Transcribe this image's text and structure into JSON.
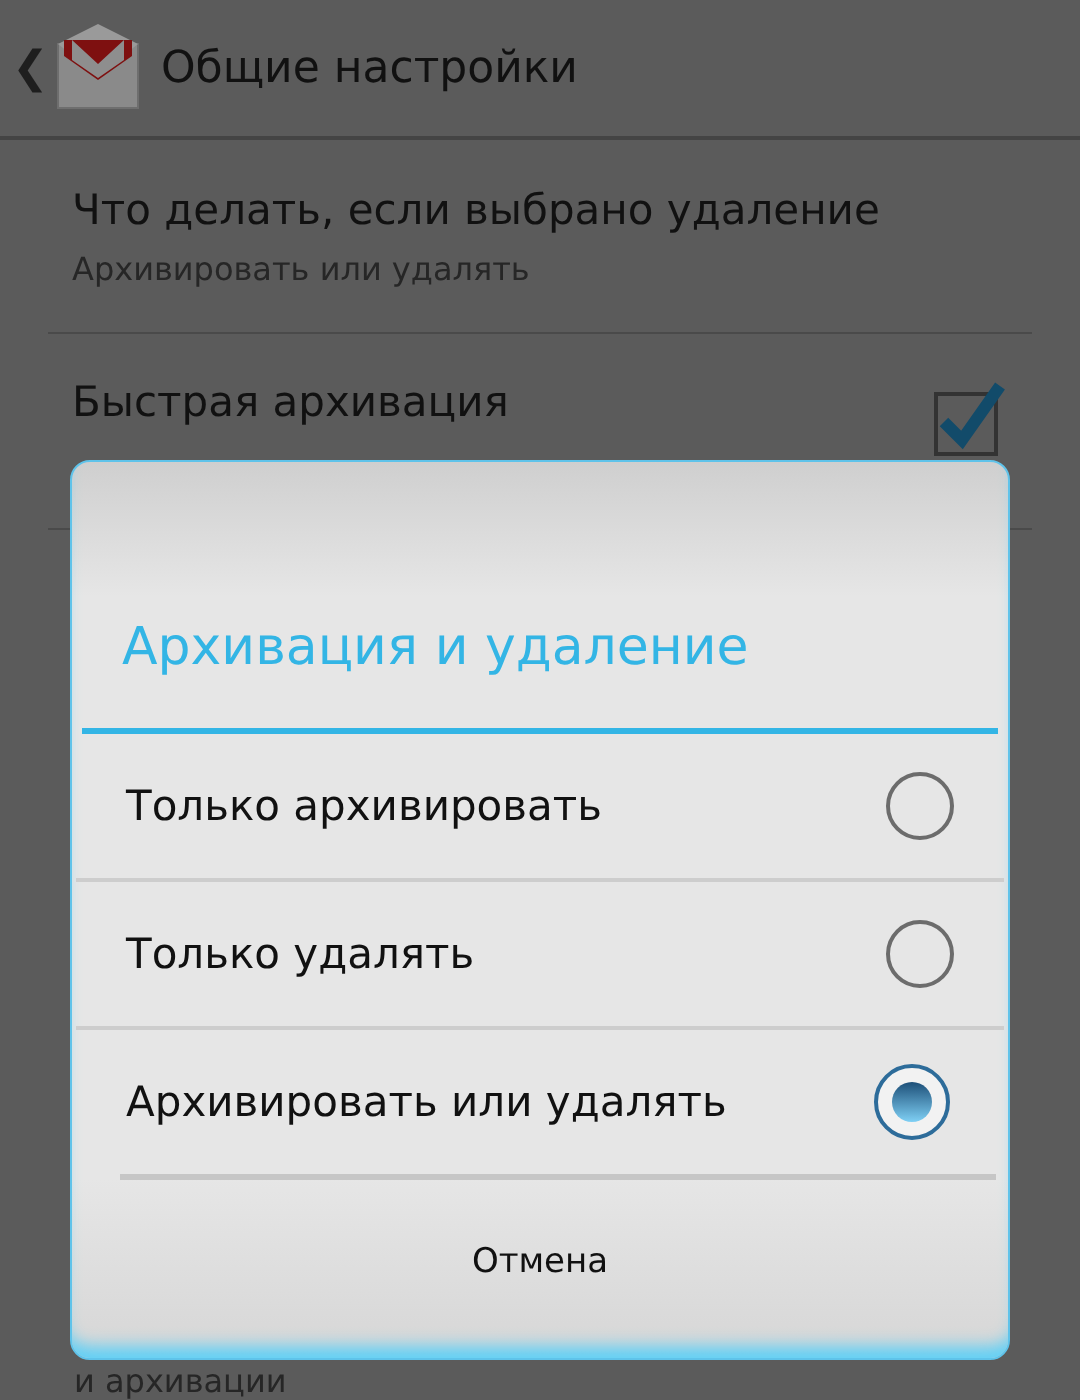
{
  "action_bar": {
    "back": "❮",
    "title": "Общие настройки"
  },
  "settings": [
    {
      "kind": "text",
      "title": "Что делать, если выбрано удаление",
      "subtitle": "Архивировать или удалять"
    },
    {
      "kind": "check",
      "title": "Быстрая архивация",
      "checked": true
    }
  ],
  "peek_text": "и архивации",
  "dialog": {
    "title": "Архивация и удаление",
    "options": [
      {
        "label": "Только архивировать",
        "selected": false
      },
      {
        "label": "Только удалять",
        "selected": false
      },
      {
        "label": "Архивировать или удалять",
        "selected": true
      }
    ],
    "button": "Отмена"
  }
}
